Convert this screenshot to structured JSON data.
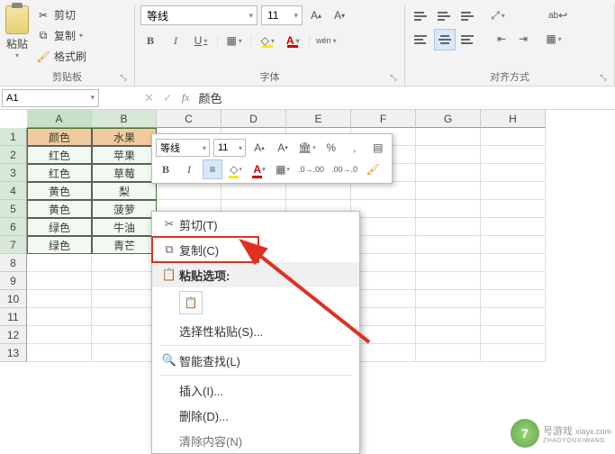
{
  "ribbon": {
    "clipboard": {
      "paste_label": "粘贴",
      "cut_label": "剪切",
      "copy_label": "复制",
      "format_painter_label": "格式刷",
      "group_label": "剪贴板"
    },
    "font": {
      "name": "等线",
      "size": "11",
      "bold": "B",
      "italic": "I",
      "underline": "U",
      "fill_letter": "A",
      "color_letter": "A",
      "wen_label": "wén",
      "group_label": "字体"
    },
    "alignment": {
      "wrap_label": "ab",
      "group_label": "对齐方式"
    }
  },
  "name_box": "A1",
  "formula_value": "颜色",
  "fx_label": "fx",
  "columns": [
    "A",
    "B",
    "C",
    "D",
    "E",
    "F",
    "G",
    "H"
  ],
  "rows": [
    "1",
    "2",
    "3",
    "4",
    "5",
    "6",
    "7",
    "8",
    "9",
    "10",
    "11",
    "12",
    "13"
  ],
  "table": {
    "headers": [
      "颜色",
      "水果"
    ],
    "data": [
      [
        "红色",
        "苹果"
      ],
      [
        "红色",
        "草莓"
      ],
      [
        "黄色",
        "梨"
      ],
      [
        "黄色",
        "菠萝"
      ],
      [
        "绿色",
        "牛油"
      ],
      [
        "绿色",
        "青芒"
      ]
    ]
  },
  "mini_toolbar": {
    "font": "等线",
    "size": "11",
    "bold": "B",
    "italic": "I",
    "color_letter": "A",
    "percent": "%",
    "comma": ","
  },
  "context_menu": {
    "cut": "剪切(T)",
    "copy": "复制(C)",
    "paste_options_header": "粘贴选项:",
    "paste_special": "选择性粘贴(S)...",
    "smart_lookup": "智能查找(L)",
    "insert": "插入(I)...",
    "delete": "删除(D)...",
    "clear_partial": "清除内容(N)"
  },
  "watermark": {
    "brand": "号游戏",
    "url": "xiayx.com",
    "sub": "ZHAOYOUXIWANG"
  }
}
